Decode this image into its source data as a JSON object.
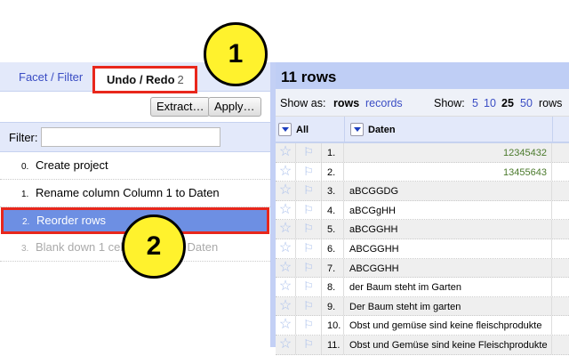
{
  "left": {
    "tabs": [
      {
        "label": "Facet / Filter"
      },
      {
        "label": "Undo / Redo",
        "count": "2"
      }
    ],
    "buttons": {
      "extract": "Extract…",
      "apply": "Apply…"
    },
    "filter_label": "Filter:",
    "filter_value": "",
    "history": [
      {
        "n": "0.",
        "label": "Create project"
      },
      {
        "n": "1.",
        "label": "Rename column Column 1 to Daten"
      },
      {
        "n": "2.",
        "label": "Reorder rows"
      },
      {
        "n": "3.",
        "label": "Blank down 1 cells in column Daten"
      }
    ]
  },
  "right": {
    "title": "11 rows",
    "show_as": "Show as:",
    "rows": "rows",
    "records": "records",
    "show": "Show:",
    "sizes": [
      "5",
      "10",
      "25",
      "50"
    ],
    "rows_suffix": "rows",
    "col_all": "All",
    "col_daten": "Daten",
    "data": [
      {
        "n": "1.",
        "v": "12345432",
        "num": true
      },
      {
        "n": "2.",
        "v": "13455643",
        "num": true
      },
      {
        "n": "3.",
        "v": "aBCGGDG"
      },
      {
        "n": "4.",
        "v": "aBCGgHH"
      },
      {
        "n": "5.",
        "v": "aBCGGHH"
      },
      {
        "n": "6.",
        "v": "ABCGGHH"
      },
      {
        "n": "7.",
        "v": "ABCGGHH"
      },
      {
        "n": "8.",
        "v": "der Baum steht im Garten"
      },
      {
        "n": "9.",
        "v": "Der Baum steht im garten"
      },
      {
        "n": "10.",
        "v": "Obst und gemüse sind keine fleischprodukte"
      },
      {
        "n": "11.",
        "v": "Obst und Gemüse sind keine Fleischprodukte"
      }
    ]
  },
  "callouts": [
    "1",
    "2"
  ]
}
